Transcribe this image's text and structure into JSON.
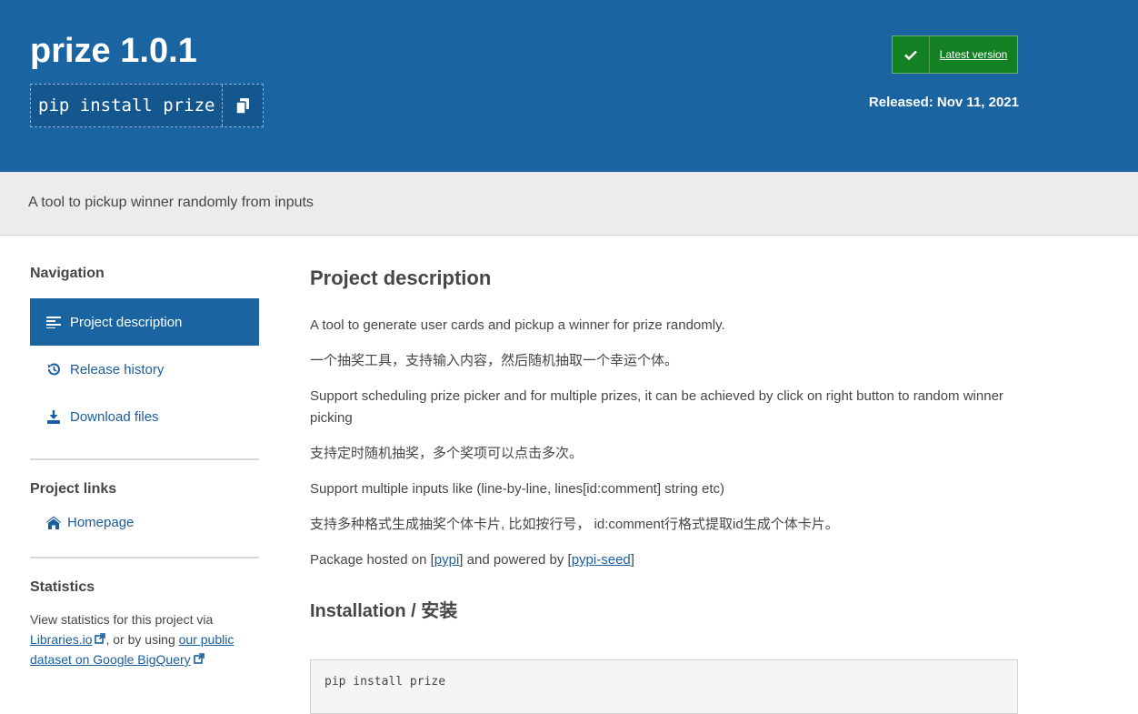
{
  "header": {
    "package_title": "prize 1.0.1",
    "pip_command": "pip install prize",
    "latest_version_label": "Latest version",
    "released_label": "Released: Nov 11, 2021"
  },
  "summary": "A tool to pickup winner randomly from inputs",
  "sidebar": {
    "navigation_heading": "Navigation",
    "nav_items": [
      {
        "label": "Project description",
        "icon": "align-left-icon"
      },
      {
        "label": "Release history",
        "icon": "history-icon"
      },
      {
        "label": "Download files",
        "icon": "download-icon"
      }
    ],
    "project_links_heading": "Project links",
    "homepage_label": "Homepage",
    "statistics_heading": "Statistics",
    "statistics_text_1": "View statistics for this project via",
    "statistics_link_1": "Libraries.io",
    "statistics_text_2": ", or by using",
    "statistics_link_2": "our public dataset on Google BigQuery"
  },
  "main": {
    "description_heading": "Project description",
    "paragraphs": [
      "A tool to generate user cards and pickup a winner for prize randomly.",
      "一个抽奖工具，支持输入内容，然后随机抽取一个幸运个体。",
      "Support scheduling prize picker and for multiple prizes, it can be achieved by click on right button to random winner picking",
      "支持定时随机抽奖，多个奖项可以点击多次。",
      "Support multiple inputs like (line-by-line, lines[id:comment] string etc)",
      "支持多种格式生成抽奖个体卡片, 比如按行号， id:comment行格式提取id生成个体卡片。"
    ],
    "hosted_prefix": "Package hosted on [",
    "hosted_link_1": "pypi",
    "hosted_middle": "] and powered by [",
    "hosted_link_2": "pypi-seed",
    "hosted_suffix": "]",
    "installation_heading": "Installation / 安装",
    "install_code": "pip install prize"
  },
  "colors": {
    "banner_blue": "#1b64a2",
    "latest_green": "#148024",
    "link_blue": "#1a5ea0",
    "summary_gray": "#ececec"
  }
}
